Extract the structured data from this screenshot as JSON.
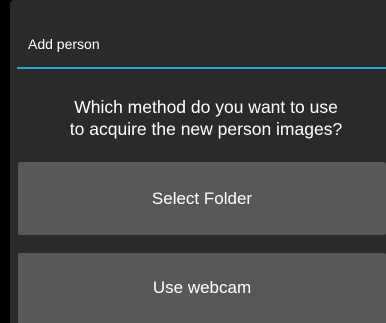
{
  "dialog": {
    "title": "Add person",
    "question": "Which method do you want to use\nto acquire the new person images?",
    "buttons": {
      "select_folder": "Select Folder",
      "use_webcam": "Use webcam"
    }
  },
  "colors": {
    "accent": "#2aa6d6",
    "dialog_background": "#2a2a2a",
    "button_background": "#585858"
  }
}
